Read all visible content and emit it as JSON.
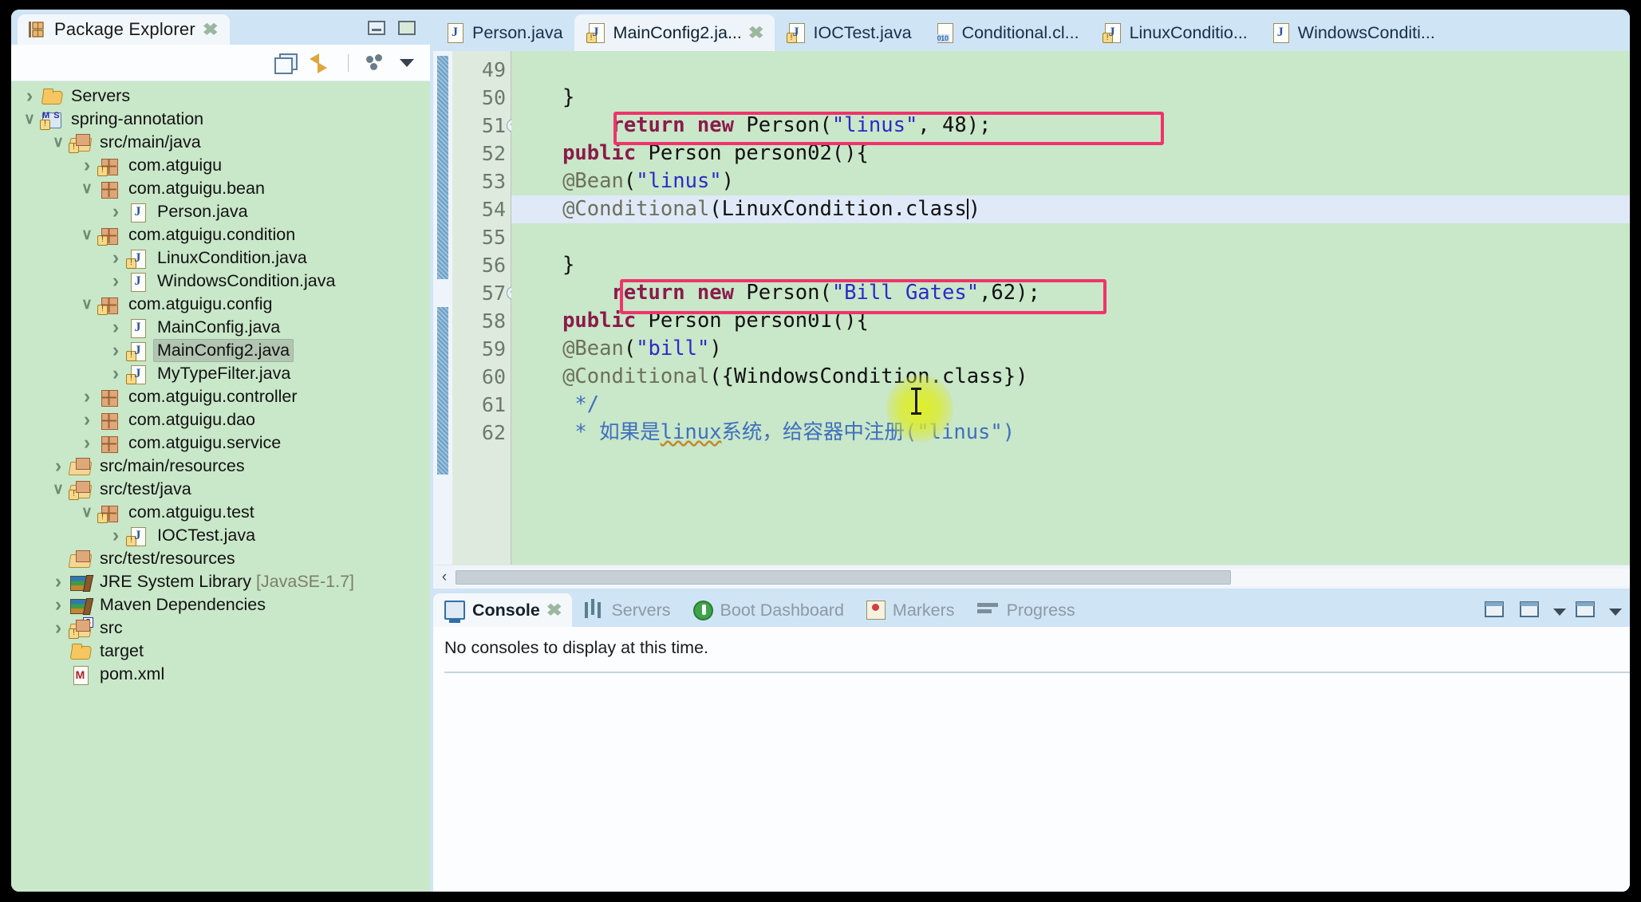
{
  "explorer": {
    "tab_label": "Package Explorer",
    "tab_icon": "package-explorer-icon",
    "close_glyph": "✖",
    "toolbar": {
      "collapse_all": "collapse-all-icon",
      "link_with_editor": "link-with-editor-icon",
      "view_menu_dots": "view-menu-icon",
      "view_menu_caret": "chevron-down-icon"
    },
    "window_buttons": {
      "minimize": "minimize-icon",
      "maximize": "maximize-icon"
    },
    "tree": [
      {
        "label": "Servers",
        "depth": 1,
        "arrow": "closed",
        "icon": "folder",
        "warn": false
      },
      {
        "label": "spring-annotation",
        "depth": 1,
        "arrow": "open",
        "icon": "msprj",
        "warn": true
      },
      {
        "label": "src/main/java",
        "depth": 2,
        "arrow": "open",
        "icon": "srcfolder",
        "warn": true
      },
      {
        "label": "com.atguigu",
        "depth": 3,
        "arrow": "closed",
        "icon": "pkg",
        "warn": true
      },
      {
        "label": "com.atguigu.bean",
        "depth": 3,
        "arrow": "open",
        "icon": "pkg",
        "warn": false
      },
      {
        "label": "Person.java",
        "depth": 4,
        "arrow": "closed",
        "icon": "jfile",
        "warn": false
      },
      {
        "label": "com.atguigu.condition",
        "depth": 3,
        "arrow": "open",
        "icon": "pkg",
        "warn": true
      },
      {
        "label": "LinuxCondition.java",
        "depth": 4,
        "arrow": "closed",
        "icon": "jfile",
        "warn": true
      },
      {
        "label": "WindowsCondition.java",
        "depth": 4,
        "arrow": "closed",
        "icon": "jfile",
        "warn": false
      },
      {
        "label": "com.atguigu.config",
        "depth": 3,
        "arrow": "open",
        "icon": "pkg",
        "warn": true
      },
      {
        "label": "MainConfig.java",
        "depth": 4,
        "arrow": "closed",
        "icon": "jfile",
        "warn": false
      },
      {
        "label": "MainConfig2.java",
        "depth": 4,
        "arrow": "closed",
        "icon": "jfile",
        "warn": true,
        "selected": true
      },
      {
        "label": "MyTypeFilter.java",
        "depth": 4,
        "arrow": "closed",
        "icon": "jfile",
        "warn": true
      },
      {
        "label": "com.atguigu.controller",
        "depth": 3,
        "arrow": "closed",
        "icon": "pkg",
        "warn": false
      },
      {
        "label": "com.atguigu.dao",
        "depth": 3,
        "arrow": "closed",
        "icon": "pkg",
        "warn": false
      },
      {
        "label": "com.atguigu.service",
        "depth": 3,
        "arrow": "closed",
        "icon": "pkg",
        "warn": false
      },
      {
        "label": "src/main/resources",
        "depth": 2,
        "arrow": "closed",
        "icon": "srcfolder",
        "warn": false
      },
      {
        "label": "src/test/java",
        "depth": 2,
        "arrow": "open",
        "icon": "srcfolder",
        "warn": true
      },
      {
        "label": "com.atguigu.test",
        "depth": 3,
        "arrow": "open",
        "icon": "pkg",
        "warn": true
      },
      {
        "label": "IOCTest.java",
        "depth": 4,
        "arrow": "closed",
        "icon": "jfile",
        "warn": true
      },
      {
        "label": "src/test/resources",
        "depth": 2,
        "arrow": "none",
        "icon": "srcfolder",
        "warn": false
      },
      {
        "label": "JRE System Library",
        "suffix": " [JavaSE-1.7]",
        "depth": 2,
        "arrow": "closed",
        "icon": "lib",
        "warn": false
      },
      {
        "label": "Maven Dependencies",
        "depth": 2,
        "arrow": "closed",
        "icon": "lib",
        "warn": false
      },
      {
        "label": "src",
        "depth": 2,
        "arrow": "closed",
        "icon": "srcfolder",
        "warn": true,
        "srcbadge": "S"
      },
      {
        "label": "target",
        "depth": 2,
        "arrow": "none",
        "icon": "folder",
        "warn": false
      },
      {
        "label": "pom.xml",
        "depth": 2,
        "arrow": "none",
        "icon": "xmlf",
        "warn": false
      }
    ]
  },
  "editor": {
    "tabs": [
      {
        "label": "Person.java",
        "icon": "java",
        "warn": false,
        "active": false,
        "closable": false
      },
      {
        "label": "MainConfig2.ja...",
        "icon": "java",
        "warn": true,
        "active": true,
        "closable": true
      },
      {
        "label": "IOCTest.java",
        "icon": "java",
        "warn": true,
        "active": false,
        "closable": false
      },
      {
        "label": "Conditional.cl...",
        "icon": "clazz",
        "warn": false,
        "active": false,
        "closable": false
      },
      {
        "label": "LinuxConditio...",
        "icon": "java",
        "warn": true,
        "active": false,
        "closable": false
      },
      {
        "label": "WindowsConditi...",
        "icon": "java",
        "warn": false,
        "active": false,
        "closable": false
      }
    ],
    "close_glyph": "✖",
    "lines": [
      {
        "num": "49",
        "fold": false,
        "current": false,
        "segs": [
          {
            "t": "    ",
            "c": "plain"
          },
          {
            "t": "* ",
            "c": "cmt"
          },
          {
            "t": "如果是",
            "c": "cmt"
          },
          {
            "t": "linux",
            "c": "cmt-wavy"
          },
          {
            "t": "系统，给容器中注册",
            "c": "cmt"
          },
          {
            "t": "(\"linus\")",
            "c": "cmt"
          }
        ]
      },
      {
        "num": "50",
        "fold": false,
        "current": false,
        "segs": [
          {
            "t": "    ",
            "c": "plain"
          },
          {
            "t": "*/",
            "c": "cmt"
          }
        ]
      },
      {
        "num": "51",
        "fold": true,
        "current": false,
        "segs": [
          {
            "t": "   ",
            "c": "plain"
          },
          {
            "t": "@Conditional",
            "c": "ann"
          },
          {
            "t": "({WindowsCondition.class})",
            "c": "plain"
          }
        ]
      },
      {
        "num": "52",
        "fold": false,
        "current": false,
        "segs": [
          {
            "t": "   ",
            "c": "plain"
          },
          {
            "t": "@Bean",
            "c": "ann"
          },
          {
            "t": "(",
            "c": "plain"
          },
          {
            "t": "\"bill\"",
            "c": "str"
          },
          {
            "t": ")",
            "c": "plain"
          }
        ]
      },
      {
        "num": "53",
        "fold": false,
        "current": false,
        "segs": [
          {
            "t": "   ",
            "c": "plain"
          },
          {
            "t": "public",
            "c": "kw"
          },
          {
            "t": " Person person01(){",
            "c": "plain"
          }
        ]
      },
      {
        "num": "54",
        "fold": false,
        "current": false,
        "segs": [
          {
            "t": "       ",
            "c": "plain"
          },
          {
            "t": "return new",
            "c": "kw"
          },
          {
            "t": " Person(",
            "c": "plain"
          },
          {
            "t": "\"Bill Gates\"",
            "c": "str"
          },
          {
            "t": ",62);",
            "c": "plain"
          }
        ]
      },
      {
        "num": "55",
        "fold": false,
        "current": false,
        "segs": [
          {
            "t": "   }",
            "c": "plain"
          }
        ]
      },
      {
        "num": "56",
        "fold": false,
        "current": false,
        "segs": []
      },
      {
        "num": "57",
        "fold": true,
        "current": true,
        "segs": [
          {
            "t": "   ",
            "c": "plain"
          },
          {
            "t": "@Conditional",
            "c": "ann"
          },
          {
            "t": "(LinuxCondition.class",
            "c": "plain"
          },
          {
            "t": "|",
            "c": "caret"
          },
          {
            "t": ")",
            "c": "plain"
          }
        ]
      },
      {
        "num": "58",
        "fold": false,
        "current": false,
        "segs": [
          {
            "t": "   ",
            "c": "plain"
          },
          {
            "t": "@Bean",
            "c": "ann"
          },
          {
            "t": "(",
            "c": "plain"
          },
          {
            "t": "\"linus\"",
            "c": "str"
          },
          {
            "t": ")",
            "c": "plain"
          }
        ]
      },
      {
        "num": "59",
        "fold": false,
        "current": false,
        "segs": [
          {
            "t": "   ",
            "c": "plain"
          },
          {
            "t": "public",
            "c": "kw"
          },
          {
            "t": " Person person02(){",
            "c": "plain"
          }
        ]
      },
      {
        "num": "60",
        "fold": false,
        "current": false,
        "segs": [
          {
            "t": "       ",
            "c": "plain"
          },
          {
            "t": "return new",
            "c": "kw"
          },
          {
            "t": " Person(",
            "c": "plain"
          },
          {
            "t": "\"linus\"",
            "c": "str"
          },
          {
            "t": ", 48);",
            "c": "plain"
          }
        ]
      },
      {
        "num": "61",
        "fold": false,
        "current": false,
        "segs": [
          {
            "t": "   }",
            "c": "plain"
          }
        ]
      },
      {
        "num": "62",
        "fold": false,
        "current": false,
        "segs": []
      }
    ],
    "highlight_color": "#f0336b",
    "highlight_boxes": [
      {
        "note": "WindowsCondition annotation on line 51"
      },
      {
        "note": "LinuxCondition annotation on line 57"
      }
    ],
    "scroll": {
      "left_arrow": "‹"
    }
  },
  "console": {
    "tabs": [
      {
        "label": "Console",
        "icon": "console-icon",
        "active": true,
        "closable": true
      },
      {
        "label": "Servers",
        "icon": "servers-icon",
        "active": false,
        "closable": false
      },
      {
        "label": "Boot Dashboard",
        "icon": "boot-dashboard-icon",
        "active": false,
        "closable": false
      },
      {
        "label": "Markers",
        "icon": "markers-icon",
        "active": false,
        "closable": false
      },
      {
        "label": "Progress",
        "icon": "progress-icon",
        "active": false,
        "closable": false
      }
    ],
    "close_glyph": "✖",
    "message": "No consoles to display at this time.",
    "toolbar": [
      {
        "icon": "open-console-icon"
      },
      {
        "icon": "display-selected-console-icon"
      },
      {
        "icon": "chevron-down-icon"
      },
      {
        "icon": "new-console-view-icon"
      },
      {
        "icon": "chevron-down-icon"
      }
    ]
  }
}
